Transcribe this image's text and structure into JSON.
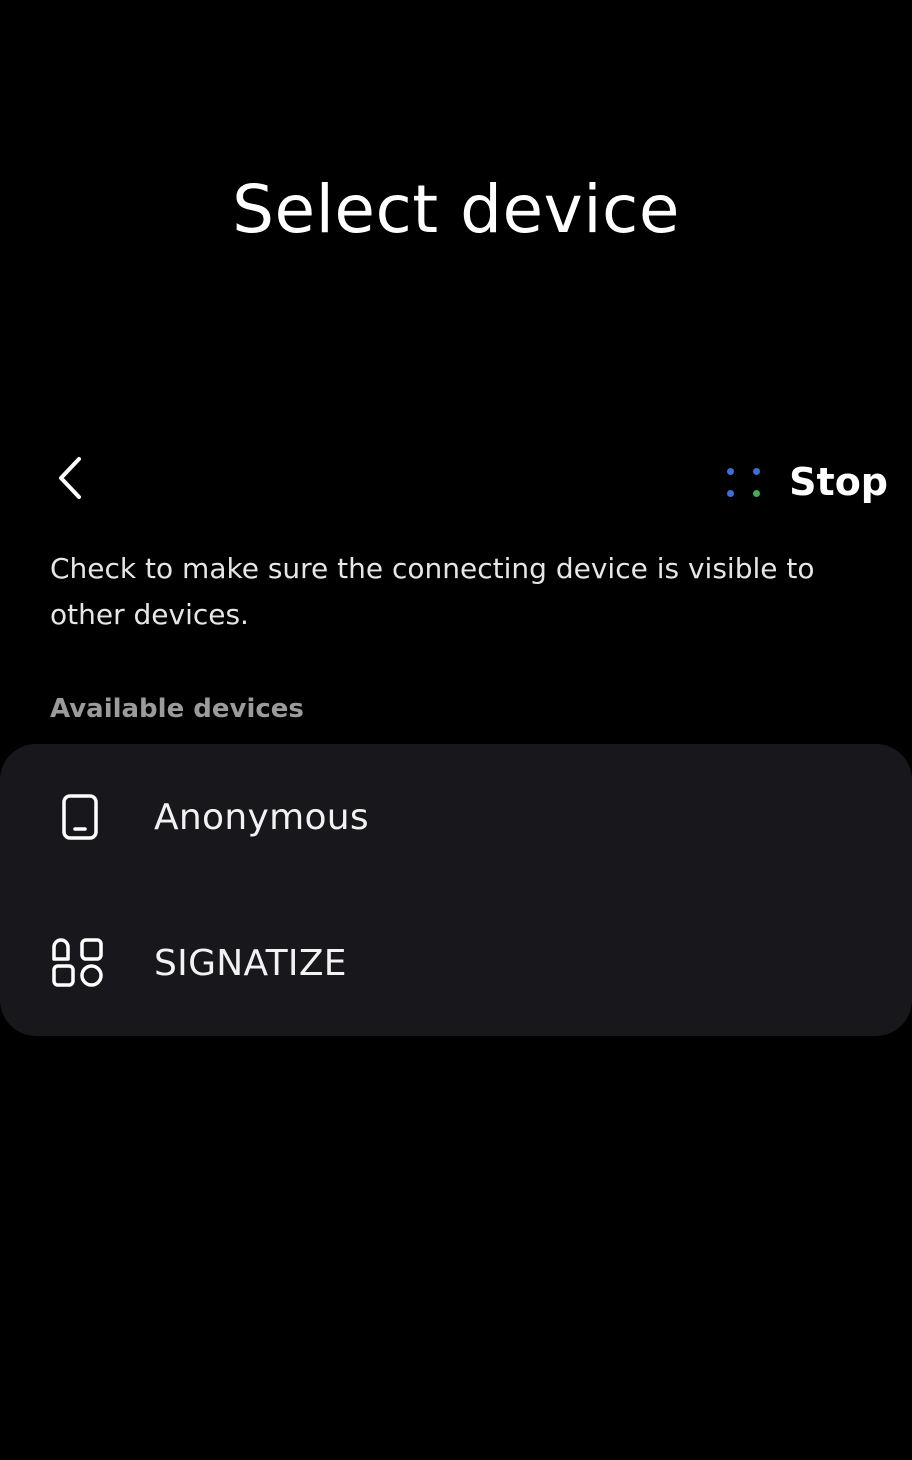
{
  "header": {
    "title": "Select device"
  },
  "toolbar": {
    "back_icon": "chevron-left-icon",
    "scan_icon": "scanning-dots-icon",
    "stop_label": "Stop"
  },
  "hint_text": "Check to make sure the connecting device is visible to other devices.",
  "devices": {
    "section_label": "Available devices",
    "items": [
      {
        "name": "Anonymous",
        "icon": "tablet-icon"
      },
      {
        "name": "SIGNATIZE",
        "icon": "apps-grid-icon"
      }
    ]
  },
  "colors": {
    "background": "#000000",
    "card": "#18181c",
    "scan_dot_blue": "#3b6fd6",
    "scan_dot_green": "#3fae5a"
  }
}
